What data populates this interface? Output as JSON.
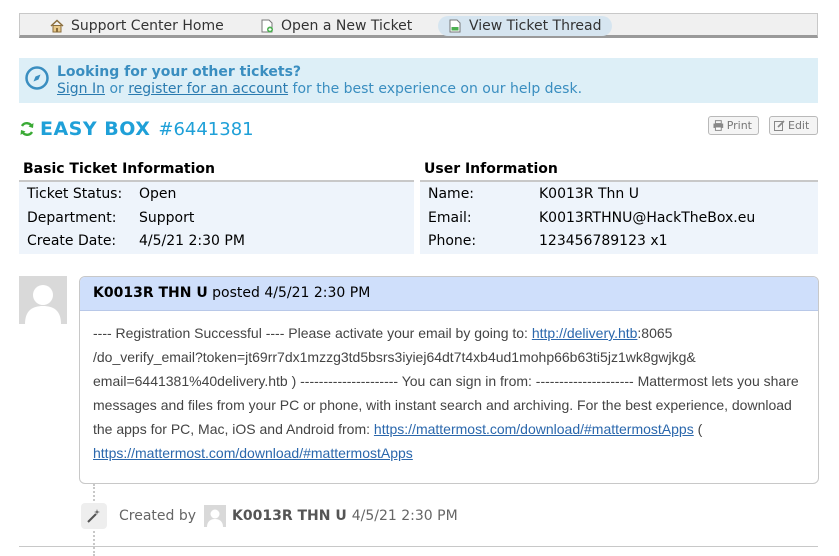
{
  "nav": {
    "items": [
      {
        "label": "Support Center Home",
        "icon": "home-icon"
      },
      {
        "label": "Open a New Ticket",
        "icon": "new-ticket-icon"
      },
      {
        "label": "View Ticket Thread",
        "icon": "ticket-thread-icon",
        "active": true
      }
    ]
  },
  "banner": {
    "title": "Looking for your other tickets?",
    "sign_in": "Sign In",
    "or": "or",
    "register": "register for an account",
    "suffix": "for the best experience on our help desk."
  },
  "ticket": {
    "subject": "EASY BOX",
    "number": "#6441381",
    "print_label": "Print",
    "edit_label": "Edit"
  },
  "basic_info": {
    "heading": "Basic Ticket Information",
    "rows": [
      {
        "label": "Ticket Status:",
        "value": "Open"
      },
      {
        "label": "Department:",
        "value": "Support"
      },
      {
        "label": "Create Date:",
        "value": "4/5/21 2:30 PM"
      }
    ]
  },
  "user_info": {
    "heading": "User Information",
    "rows": [
      {
        "label": "Name:",
        "value": "K0013R Thn U"
      },
      {
        "label": "Email:",
        "value": "K0013RTHNU@HackTheBox.eu"
      },
      {
        "label": "Phone:",
        "value": "123456789123 x1"
      }
    ]
  },
  "thread": {
    "author": "K0013R THN U",
    "posted": "posted",
    "date": "4/5/21 2:30 PM",
    "message": {
      "l1_text": "---- Registration Successful ---- Please activate your email by going to: ",
      "l1_link": "http://delivery.htb",
      "l1_tail": ":8065",
      "l2": "/do_verify_email?token=jt69rr7dx1mzzg3td5bsrs3iyiej64dt7t4xb4ud1mohp66b63ti5jz1wk8gwjkg&",
      "l3": "email=6441381%40delivery.htb ) --------------------- You can sign in from: --------------------- Mattermost lets you share",
      "l4": "messages and files from your PC or phone, with instant search and archiving. For the best experience, download",
      "l5_text": "the apps for PC, Mac, iOS and Android from: ",
      "l5_link": "https://mattermost.com/download/#mattermostApps",
      "l5_tail": " (",
      "l6_link": "https://mattermost.com/download/#mattermostApps"
    }
  },
  "event": {
    "created_by": "Created by",
    "author": "K0013R THN U",
    "date": "4/5/21 2:30 PM"
  },
  "colors": {
    "accent": "#1fa0d8",
    "banner_bg": "#ddeff7",
    "thread_header_bg": "#cfdffb",
    "info_bg": "#eef4fb"
  }
}
